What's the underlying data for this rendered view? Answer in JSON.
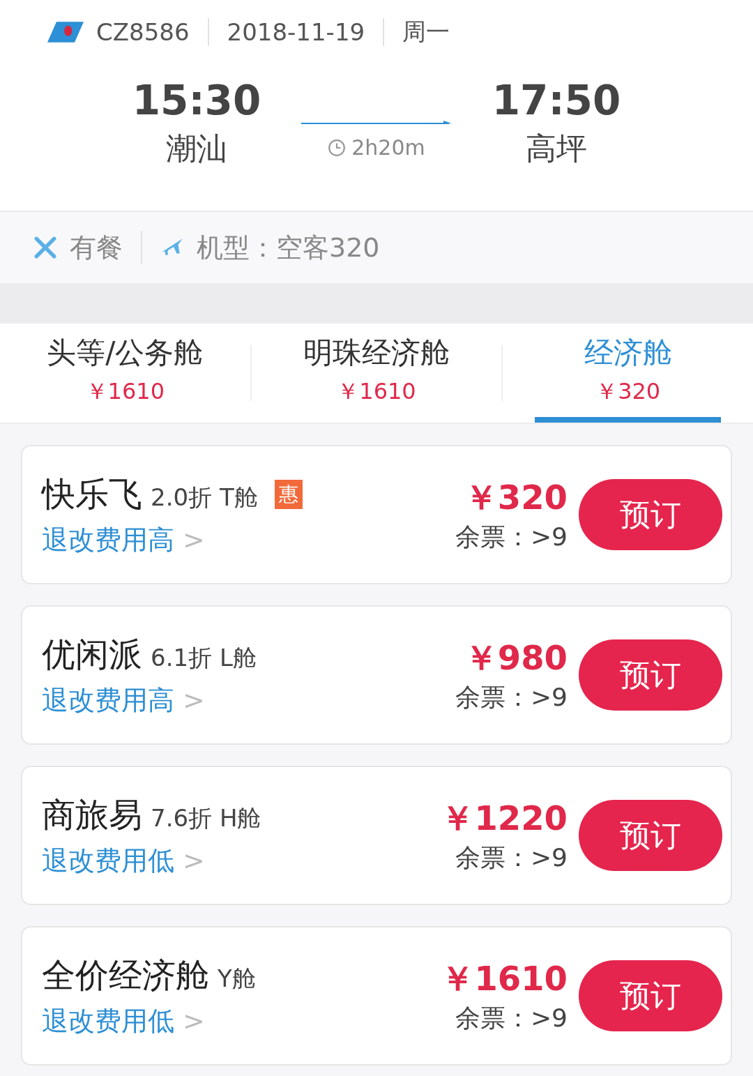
{
  "flight": {
    "number": "CZ8586",
    "date": "2018-11-19",
    "weekday": "周一"
  },
  "departure": {
    "time": "15:30",
    "city": "潮汕"
  },
  "arrival": {
    "time": "17:50",
    "city": "高坪"
  },
  "duration": "2h20m",
  "info": {
    "meal": "有餐",
    "aircraft": "机型：空客320"
  },
  "cabin_tabs": [
    {
      "label": "头等/公务舱",
      "price": "￥1610",
      "selected": false
    },
    {
      "label": "明珠经济舱",
      "price": "￥1610",
      "selected": false
    },
    {
      "label": "经济舱",
      "price": "￥320",
      "selected": true
    }
  ],
  "fares": [
    {
      "name": "快乐飞",
      "detail": "2.0折 T舱",
      "badge": "惠",
      "refund": "退改费用高",
      "more": ">",
      "price": "￥320",
      "remaining": "余票：>9",
      "button": "预订"
    },
    {
      "name": "优闲派",
      "detail": "6.1折 L舱",
      "refund": "退改费用高",
      "more": ">",
      "price": "￥980",
      "remaining": "余票：>9",
      "button": "预订"
    },
    {
      "name": "商旅易",
      "detail": "7.6折 H舱",
      "refund": "退改费用低",
      "more": ">",
      "price": "￥1220",
      "remaining": "余票：>9",
      "button": "预订"
    },
    {
      "name": "全价经济舱",
      "detail": "Y舱",
      "refund": "退改费用低",
      "more": ">",
      "price": "￥1610",
      "remaining": "余票：>9",
      "button": "预订"
    }
  ]
}
